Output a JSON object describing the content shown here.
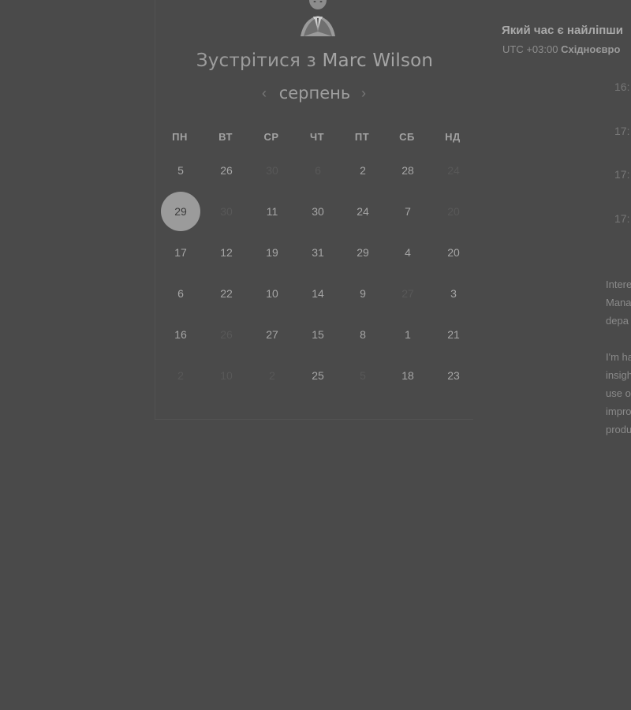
{
  "booking": {
    "title_prefix": "Зустрітися з",
    "host_name": "Marc Wilson",
    "month": "серпень",
    "prev_icon": "chevron-left-icon",
    "next_icon": "chevron-right-icon",
    "weekdays": [
      "ПН",
      "ВТ",
      "СР",
      "ЧТ",
      "ПТ",
      "СБ",
      "НД"
    ],
    "weeks": [
      [
        {
          "label": "5",
          "disabled": false
        },
        {
          "label": "26",
          "disabled": false
        },
        {
          "label": "30",
          "disabled": true
        },
        {
          "label": "6",
          "disabled": true
        },
        {
          "label": "2",
          "disabled": false
        },
        {
          "label": "28",
          "disabled": false
        },
        {
          "label": "24",
          "disabled": true
        }
      ],
      [
        {
          "label": "29",
          "disabled": false,
          "selected": true
        },
        {
          "label": "30",
          "disabled": true
        },
        {
          "label": "11",
          "disabled": false
        },
        {
          "label": "30",
          "disabled": false
        },
        {
          "label": "24",
          "disabled": false
        },
        {
          "label": "7",
          "disabled": false
        },
        {
          "label": "20",
          "disabled": true
        }
      ],
      [
        {
          "label": "17",
          "disabled": false
        },
        {
          "label": "12",
          "disabled": false
        },
        {
          "label": "19",
          "disabled": false
        },
        {
          "label": "31",
          "disabled": false
        },
        {
          "label": "29",
          "disabled": false
        },
        {
          "label": "4",
          "disabled": false
        },
        {
          "label": "20",
          "disabled": false
        }
      ],
      [
        {
          "label": "6",
          "disabled": false
        },
        {
          "label": "22",
          "disabled": false
        },
        {
          "label": "10",
          "disabled": false
        },
        {
          "label": "14",
          "disabled": false
        },
        {
          "label": "9",
          "disabled": false
        },
        {
          "label": "27",
          "disabled": true
        },
        {
          "label": "3",
          "disabled": false
        }
      ],
      [
        {
          "label": "16",
          "disabled": false
        },
        {
          "label": "26",
          "disabled": true
        },
        {
          "label": "27",
          "disabled": false
        },
        {
          "label": "15",
          "disabled": false
        },
        {
          "label": "8",
          "disabled": false
        },
        {
          "label": "1",
          "disabled": false
        },
        {
          "label": "21",
          "disabled": false
        }
      ],
      [
        {
          "label": "2",
          "disabled": true
        },
        {
          "label": "10",
          "disabled": true
        },
        {
          "label": "2",
          "disabled": true
        },
        {
          "label": "25",
          "disabled": false
        },
        {
          "label": "5",
          "disabled": true
        },
        {
          "label": "18",
          "disabled": false
        },
        {
          "label": "23",
          "disabled": false
        }
      ]
    ]
  },
  "times": {
    "title": "Який час є найліпши",
    "tz_offset": "UTC +03:00",
    "tz_name": "Східноєвро",
    "slots": [
      "16:",
      "17:",
      "17:",
      "17:"
    ]
  },
  "description": {
    "lines": [
      "Intere",
      "Mana",
      "depa",
      "",
      "I'm ha",
      "insigh",
      "use o",
      "impro",
      "produ"
    ]
  },
  "colors": {
    "background": "#4a4a4a",
    "selected_day": "#9b9b9b"
  }
}
